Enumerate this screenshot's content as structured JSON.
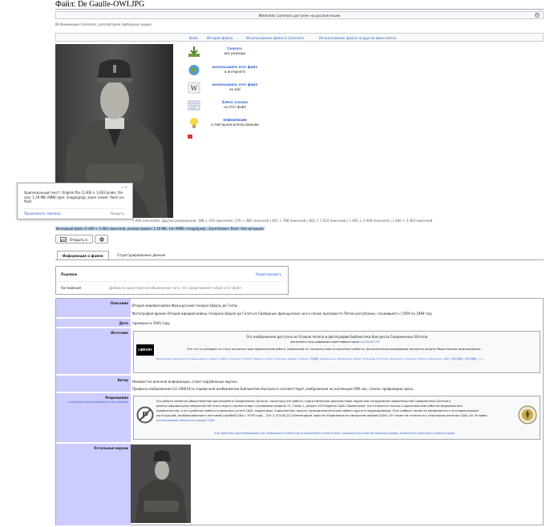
{
  "page": {
    "title": "Файл: De Gaulle-OWI.JPG",
    "notice": "Wikimedia Commons доступен на русском языке",
    "from": "Из Викимедиа Commons, репозитория свободных медиа"
  },
  "file_nav": [
    "Файл",
    "История файла",
    "Использование файла в Commons",
    "Использование файла на других вики-сайтах"
  ],
  "sidebar": [
    {
      "title": "Скачать",
      "sub": "все размеры",
      "icon": "download-icon"
    },
    {
      "title": "использовать этот файл",
      "sub": "в интернете",
      "icon": "globe-icon"
    },
    {
      "title": "использовать этот файл",
      "sub": "на wiki",
      "icon": "wikipedia-icon"
    },
    {
      "title": "Блеск ссылка",
      "sub": "на этот файл",
      "icon": "email-icon"
    },
    {
      "title": "информация",
      "sub": "о повторном использовании",
      "icon": "lightbulb-icon"
    }
  ],
  "popup": {
    "text": "Оригинальный текст: Original file (2,400 × 3,063 pixels, file size: 1.19 MB, MIME type: image/jpeg); zoom viewer: flash (no flash",
    "link": "Предложить перевод",
    "dismiss": "Закрыть"
  },
  "resolution_line": "(.064 пикселей). Другие разрешения: 188 × 240 пикселей | 376 × 480 пикселей | 601 × 768 пикселей | 802 × 1 024 пикселей | 1 604 × 2 048 пикселей | 2 400 × 3 063 пикселей",
  "original_line": "Исходный файл (2 400 × 3 063 пикселей, размер файла: 1,19 МБ, тип MIME: image/jpeg) ; ZoomViewer: flash / без вспышки",
  "open_button": "Открыть в",
  "tabs": [
    "Информация о файле",
    "Структурированные данные"
  ],
  "captions": {
    "heading": "Подписи",
    "edit": "Редактировать",
    "language": "Английский",
    "placeholder": "Добавьте однострочное объяснение того, что представляет собой этот файл"
  },
  "info": {
    "description_label": "Описание",
    "description_1": "Вторая мировая война Французский генерал Шарль де Голль",
    "description_2": "Фотография времен Второй мировой войны генерала Шарля де Голля из Свободных французских сил и позже президента Пятой республики, служившего с 1959 по 1969 год.",
    "date_label": "Дата",
    "date_value": "примерно в 1945 году",
    "source_label": "Источник",
    "loc_title": "Это изображение доступно из Отдела печати и фотографий Библиотеки Конгресса Соединенных Штатов",
    "loc_sub": "Автономно под цифровым идентификатором",
    "loc_id": "cph.3b42779",
    "loc_line3": "Этот тег не указывает на статус авторских прав прикрепленной работы. Нормальный тег авторских прав по-прежнему требуется. Дополнительную информацию смотрите в разделе Общественные лицензирование.",
    "loc_line4": "Беларуская | Беларуская (тарашкевіца) | Català | Čeština | Deutsch | English | Español | Suomi | Français | Magyar | Italiano | 日本語 | Македонски | Nederlands | Polski | Português | Русский | Slovenčina | Svenska | Türkçe | Українська | 中文 | 中文(简体) | 中文(繁體) | +/−",
    "author_label": "Автор",
    "author_1": "Неизвестно военной информации, отдел зарубежных картин.",
    "author_2": "Профиль изображения (LC-USW33) в справочной изображении Библиотеки Конгресса соответствует изображения на коллекции OWI как, список профилиров здесь.",
    "license_label": "Разрешение",
    "license_sub": "(повторное использование этого файла)",
    "pd_1": "Эта работа является общественным достоянием в Соединенных Штатах, поскольку это работа, подготовленная должностным лицом или сотрудником правительства Соединенных Штатов в",
    "pd_2": "рамках официальных обязанностей этого лица в соответствии с условиями раздела 17, Глава 1, раздел 105 Кодекса США. Примечание: это относится только к оригинальным работам федерального",
    "pd_3": "правительства, а не к работам любого отдельного штата США, территории, Содружества, округа, муниципалитета или любого другого подразделения. Этот шаблон также не применяется к почтовым маркам",
    "pd_4": "конструкций, опубликованным в почтовой службой США с 1978 года... (См. § 313.6(C)(1) Компендиум практик Управления по авторским правам США). Он также не относится к некоторым монетам США; см. Условия",
    "pd_5": "использования монетного двора США.",
    "pd_6": "Этот файл был идентифицирован как свободный от известных ограничений в соответствии с законодательством об авторских правах, включая все смежные и смежные права.",
    "other_label": "Остальные версии"
  }
}
